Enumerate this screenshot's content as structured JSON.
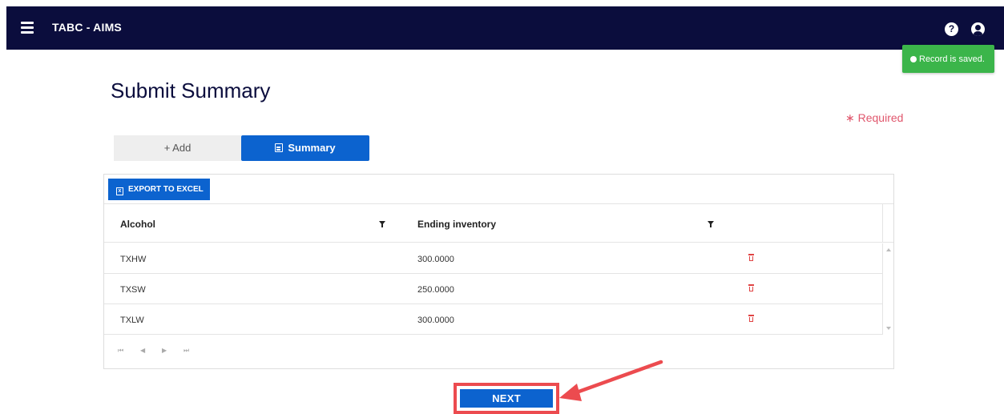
{
  "header": {
    "app_title": "TABC - AIMS",
    "menu_icon": "hamburger-icon",
    "help_icon": "question-circle-icon",
    "help_glyph": "?",
    "user_icon": "user-circle-icon",
    "bg_color": "#0b0d3d"
  },
  "toast": {
    "message": "Record is saved.",
    "color": "#3bb54a"
  },
  "page": {
    "title": "Submit Summary",
    "required_note": "∗ Required",
    "required_color": "#e0566c"
  },
  "tabs": {
    "add_label": "+ Add",
    "summary_label": "Summary",
    "active": "Summary",
    "accent": "#0c63cf"
  },
  "grid": {
    "export_label": "EXPORT TO EXCEL",
    "excel_glyph": "x",
    "columns": [
      "Alcohol",
      "Ending inventory"
    ],
    "rows": [
      {
        "alcohol": "TXHW",
        "ending_inventory": "300.0000"
      },
      {
        "alcohol": "TXSW",
        "ending_inventory": "250.0000"
      },
      {
        "alcohol": "TXLW",
        "ending_inventory": "300.0000"
      }
    ],
    "pager": {
      "first": "⏮",
      "prev": "◀",
      "next": "▶",
      "last": "⏭"
    }
  },
  "footer": {
    "next_label": "NEXT",
    "highlight_color": "#ec4b4f"
  }
}
